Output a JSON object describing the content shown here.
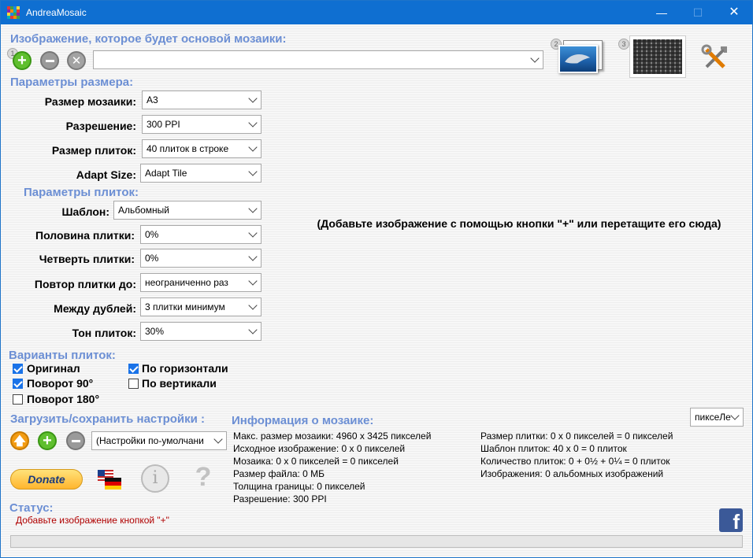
{
  "window": {
    "title": "AndreaMosaic"
  },
  "main_image": {
    "heading": "Изображение, которое будет основой мозаики:",
    "path_value": ""
  },
  "size_params": {
    "heading": "Параметры размера:",
    "rows": [
      {
        "label": "Размер мозаики:",
        "value": "A3"
      },
      {
        "label": "Разрешение:",
        "value": "300 PPI"
      },
      {
        "label": "Размер плиток:",
        "value": "40 плиток в строке"
      },
      {
        "label": "Adapt Size:",
        "value": "Adapt Tile"
      }
    ]
  },
  "tile_params": {
    "heading": "Параметры плиток:",
    "rows": [
      {
        "label": "Шаблон:",
        "value": "Альбомный"
      },
      {
        "label": "Половина плитки:",
        "value": "0%"
      },
      {
        "label": "Четверть плитки:",
        "value": "0%"
      },
      {
        "label": "Повтор плитки до:",
        "value": "неограниченно раз"
      },
      {
        "label": "Между дублей:",
        "value": "3  плитки минимум"
      },
      {
        "label": "Тон плиток:",
        "value": "30%"
      }
    ]
  },
  "variants": {
    "heading": "Варианты плиток:",
    "original": {
      "label": "Оригинал",
      "checked": true
    },
    "rot90": {
      "label": "Поворот 90°",
      "checked": true
    },
    "rot180": {
      "label": "Поворот 180°",
      "checked": false
    },
    "horizontal": {
      "label": "По горизонтали",
      "checked": true
    },
    "vertical": {
      "label": "По вертикали",
      "checked": false
    }
  },
  "settings": {
    "heading": "Загрузить/сохранить настройки :",
    "value": "(Настройки по-умолчани"
  },
  "hint": "(Добавьте изображение с помощью кнопки \"+\" или перетащите его сюда)",
  "donate": "Donate",
  "mosaic_info": {
    "heading": "Информация о мозаике:",
    "unit": "пиксеЛе",
    "left": [
      "Макс. размер мозаики: 4960 x 3425 пикселей",
      "Исходное изображение: 0 x 0 пикселей",
      "Мозаика: 0 x 0 пикселей = 0 пикселей",
      "Размер файла: 0 МБ",
      "Толщина границы: 0 пикселей",
      "Разрешение: 300 PPI"
    ],
    "right": [
      "Размер плитки: 0 x 0 пикселей = 0 пикселей",
      "Шаблон плиток: 40 x 0 = 0 плиток",
      "Количество плиток: 0 + 0½ + 0¼ = 0 плиток",
      "Изображения: 0 альбомных изображений"
    ]
  },
  "status": {
    "heading": "Статус:",
    "text": "Добавьте изображение кнопкой \"+\"",
    "progress": 0
  },
  "colors": {
    "titlebar": "#0f6fd1",
    "section": "#6c8fd4",
    "status_text": "#b00000"
  }
}
